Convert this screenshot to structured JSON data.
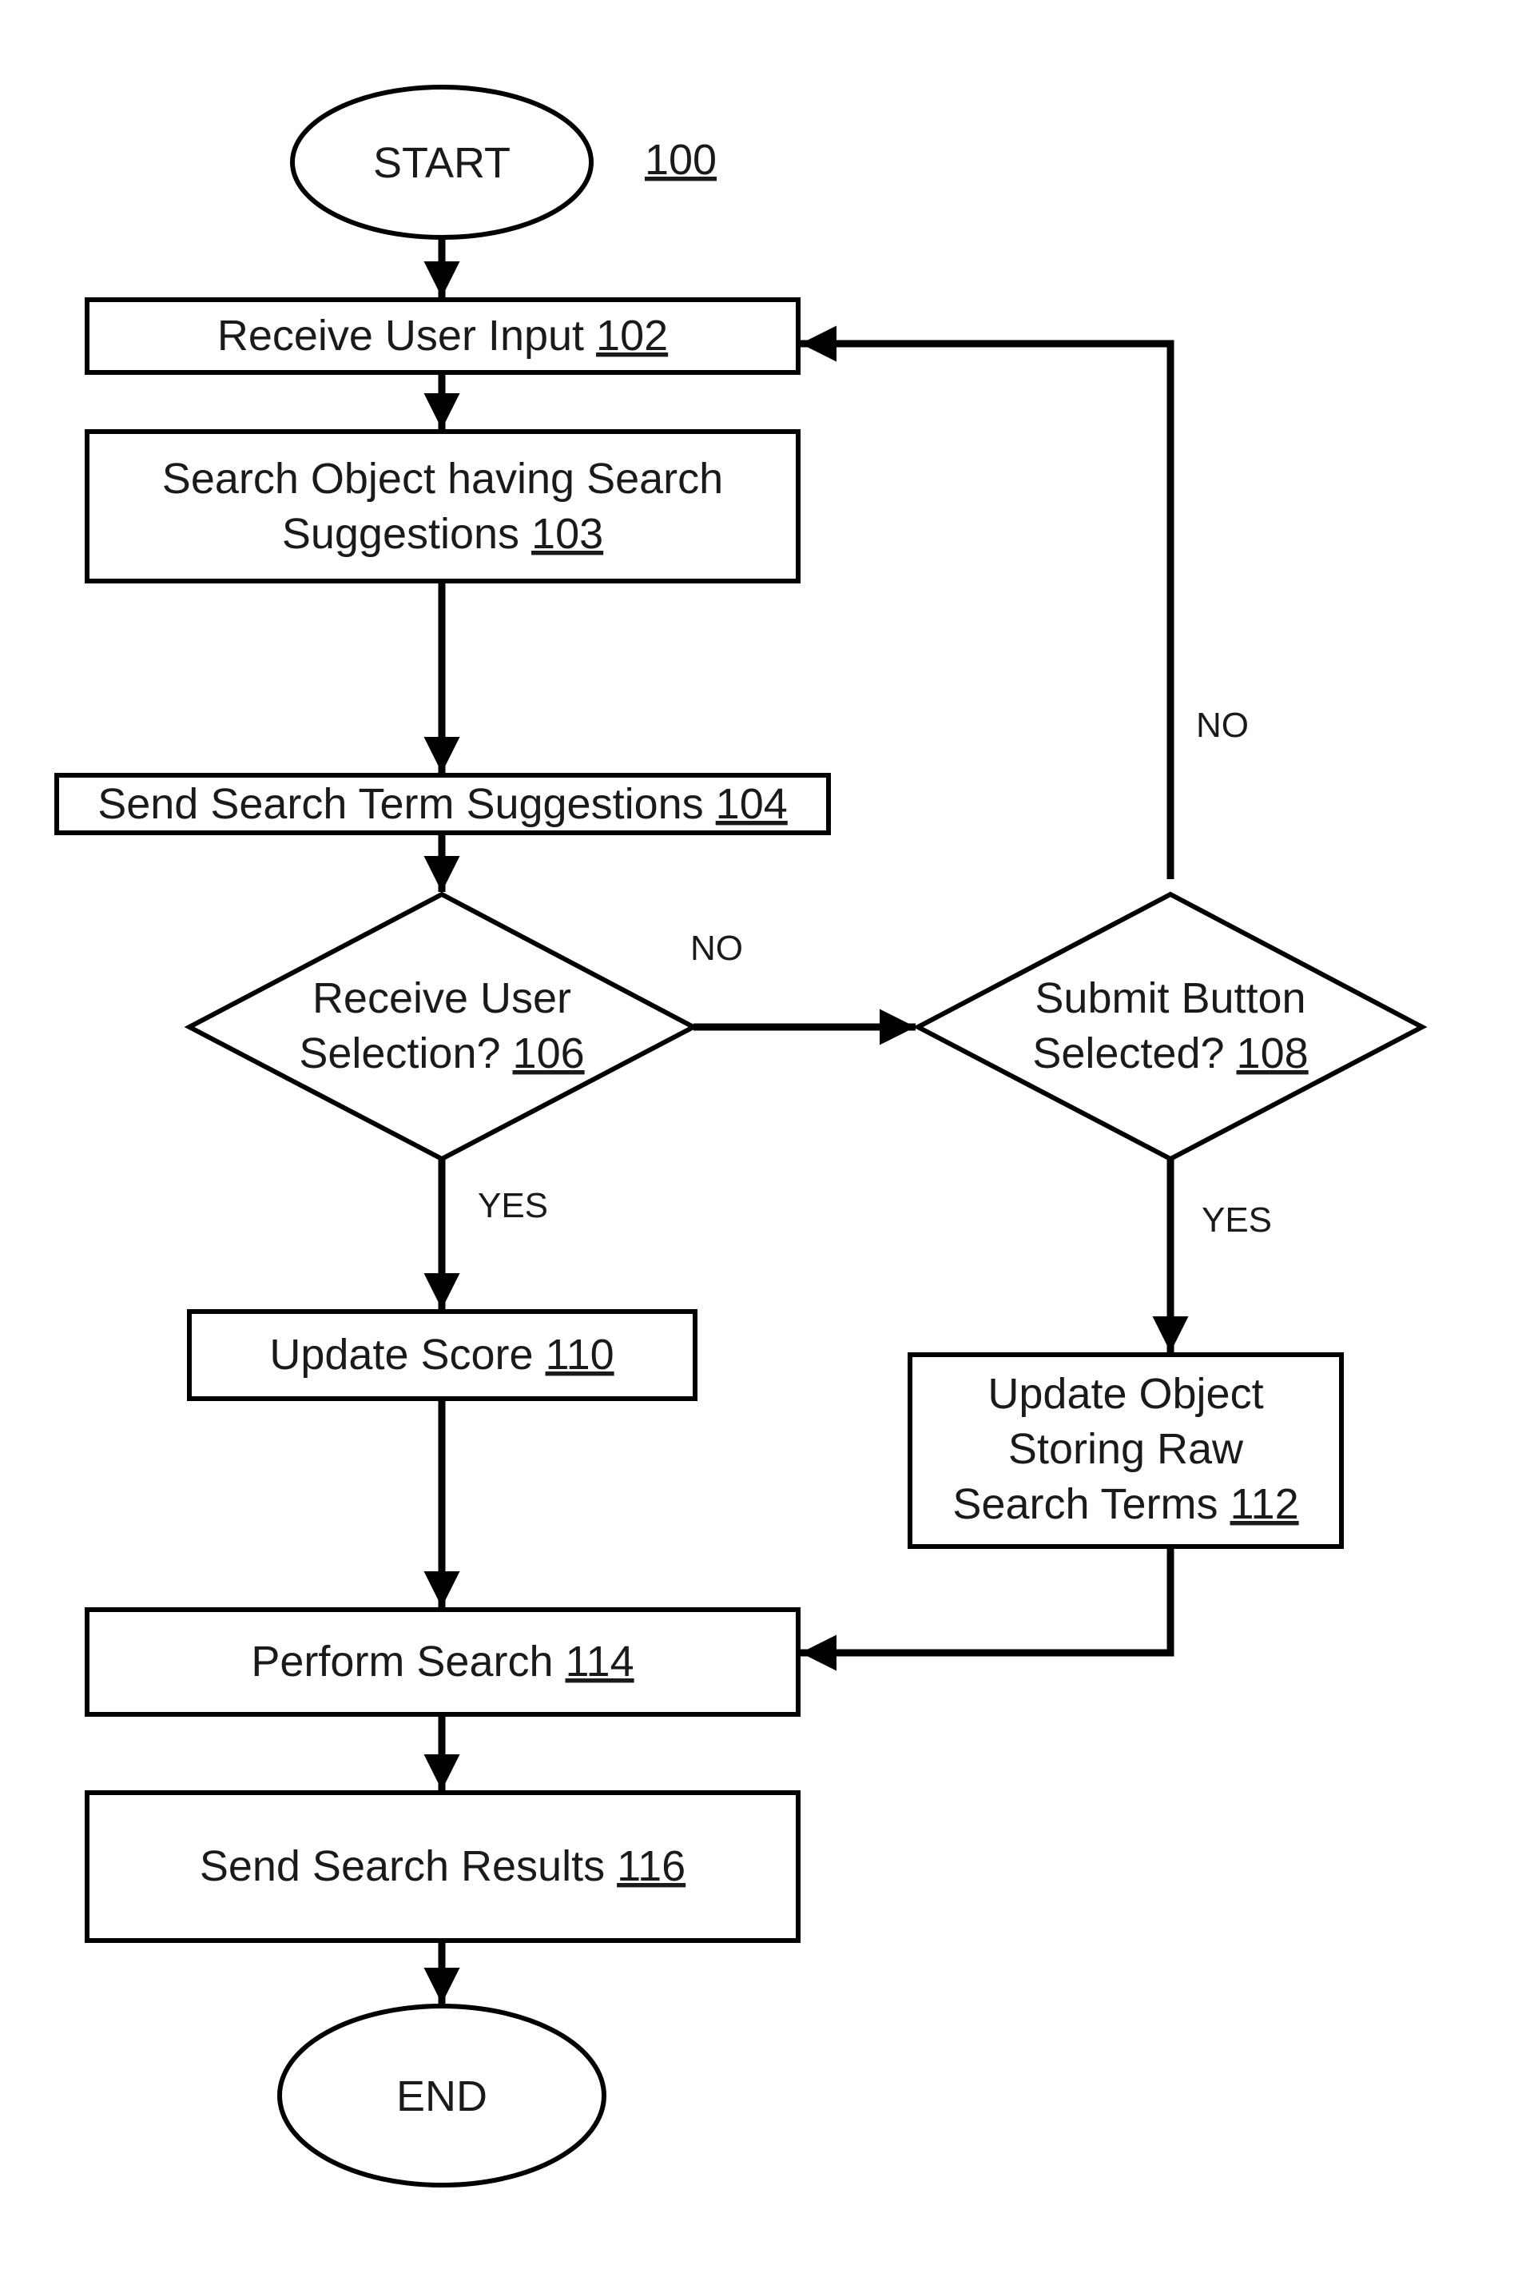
{
  "figure": {
    "ref_label": "100",
    "start": "START",
    "end": "END",
    "steps": {
      "s102": {
        "text": "Receive User Input ",
        "ref": "102"
      },
      "s103": {
        "line1": "Search Object having Search",
        "line2": "Suggestions ",
        "ref": "103"
      },
      "s104": {
        "text": "Send Search Term Suggestions ",
        "ref": "104"
      },
      "s106": {
        "line1": "Receive User",
        "line2": "Selection? ",
        "ref": "106"
      },
      "s108": {
        "line1": "Submit Button",
        "line2": "Selected? ",
        "ref": "108"
      },
      "s110": {
        "text": "Update Score ",
        "ref": "110"
      },
      "s112": {
        "line1": "Update Object",
        "line2": "Storing Raw",
        "line3": "Search Terms ",
        "ref": "112"
      },
      "s114": {
        "text": "Perform Search ",
        "ref": "114"
      },
      "s116": {
        "text": "Send Search Results ",
        "ref": "116"
      }
    },
    "edge_labels": {
      "no_106": "NO",
      "yes_106": "YES",
      "no_108": "NO",
      "yes_108": "YES"
    }
  }
}
